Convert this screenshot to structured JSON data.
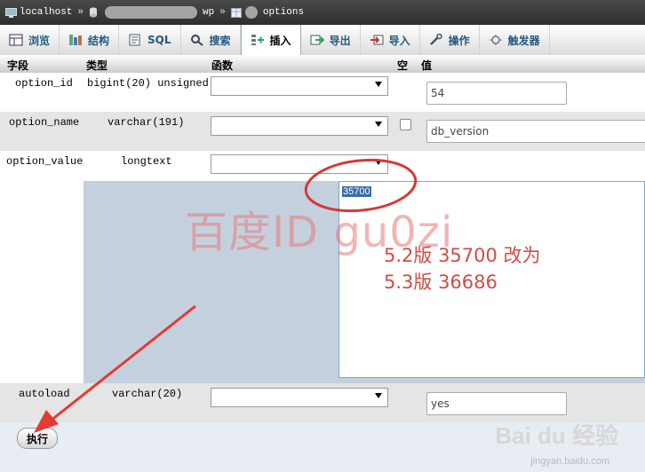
{
  "breadcrumb": {
    "server": "localhost",
    "database": "wp",
    "table": "options",
    "separator": "»"
  },
  "tabs": [
    {
      "label": "浏览",
      "icon": "browse-icon"
    },
    {
      "label": "结构",
      "icon": "structure-icon"
    },
    {
      "label": "SQL",
      "icon": "sql-icon"
    },
    {
      "label": "搜索",
      "icon": "search-icon"
    },
    {
      "label": "插入",
      "icon": "insert-icon",
      "active": true
    },
    {
      "label": "导出",
      "icon": "export-icon"
    },
    {
      "label": "导入",
      "icon": "import-icon"
    },
    {
      "label": "操作",
      "icon": "operations-icon"
    },
    {
      "label": "触发器",
      "icon": "triggers-icon"
    }
  ],
  "columns": {
    "field": "字段",
    "type": "类型",
    "function": "函数",
    "null": "空",
    "value": "值"
  },
  "rows": [
    {
      "field": "option_id",
      "type": "bigint(20) unsigned",
      "value": "54"
    },
    {
      "field": "option_name",
      "type": "varchar(191)",
      "value": "db_version"
    },
    {
      "field": "option_value",
      "type": "longtext",
      "value": "35700"
    },
    {
      "field": "autoload",
      "type": "varchar(20)",
      "value": "yes"
    }
  ],
  "submit_label": "执行",
  "annotation": {
    "watermark": "百度ID gu0zi",
    "line1": "5.2版 35700 改为",
    "line2": "5.3版 36686",
    "color": "#cf4d45"
  },
  "baidu_logo": "Bai du 经验",
  "baidu_sub": "jingyan.baidu.com"
}
